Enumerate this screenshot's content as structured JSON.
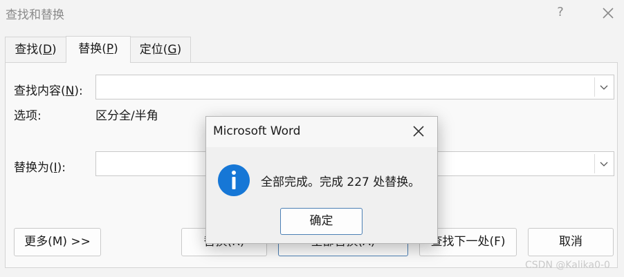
{
  "window": {
    "title": "查找和替换",
    "help_label": "?"
  },
  "tabs": [
    {
      "label": "查找(",
      "mnemonic": "D",
      "suffix": ")"
    },
    {
      "label": "替换(",
      "mnemonic": "P",
      "suffix": ")"
    },
    {
      "label": "定位(",
      "mnemonic": "G",
      "suffix": ")"
    }
  ],
  "find": {
    "label": "查找内容(",
    "mnemonic": "N",
    "suffix": "):",
    "value": ""
  },
  "options": {
    "label": "选项:",
    "value": "区分全/半角"
  },
  "replace": {
    "label": "替换为(",
    "mnemonic": "I",
    "suffix": "):",
    "value": ""
  },
  "buttons": {
    "more": "更多(M) >>",
    "replace": "替换(R)",
    "replace_all": "全部替换(A)",
    "find_next": "查找下一处(F)",
    "cancel": "取消"
  },
  "watermark": "CSDN @Kalika0-0",
  "modal": {
    "title": "Microsoft Word",
    "message": "全部完成。完成 227 处替换。",
    "ok_label": "确定",
    "icon": "info-icon",
    "icon_color": "#1677d6"
  }
}
